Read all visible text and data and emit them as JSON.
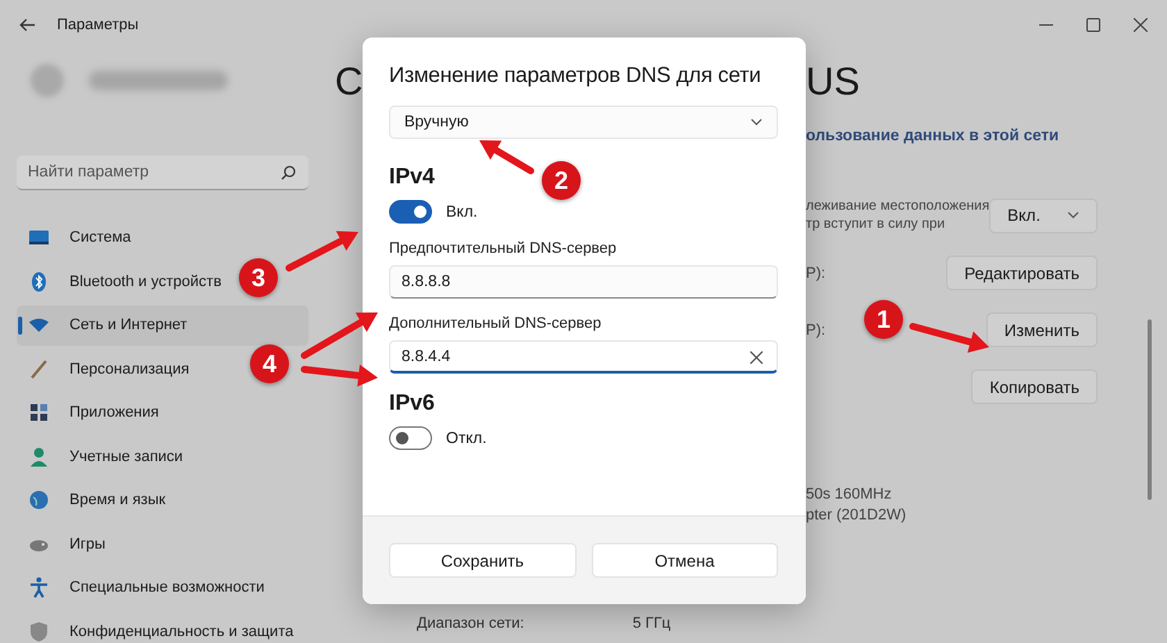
{
  "window": {
    "title": "Параметры"
  },
  "search": {
    "placeholder": "Найти параметр"
  },
  "sidebar": {
    "items": [
      {
        "label": "Система",
        "kind": "system",
        "selected": false
      },
      {
        "label": "Bluetooth и устройств",
        "kind": "bluetooth",
        "selected": false
      },
      {
        "label": "Сеть и Интернет",
        "kind": "network",
        "selected": true
      },
      {
        "label": "Персонализация",
        "kind": "brush",
        "selected": false
      },
      {
        "label": "Приложения",
        "kind": "apps",
        "selected": false
      },
      {
        "label": "Учетные записи",
        "kind": "person",
        "selected": false
      },
      {
        "label": "Время и язык",
        "kind": "globe",
        "selected": false
      },
      {
        "label": "Игры",
        "kind": "gamepad",
        "selected": false
      },
      {
        "label": "Специальные возможности",
        "kind": "accessibility",
        "selected": false
      },
      {
        "label": "Конфиденциальность и защита",
        "kind": "shield",
        "selected": false
      }
    ]
  },
  "page": {
    "heading_left": "С",
    "heading_right": "US",
    "link": "ользование данных в этой сети",
    "location_lines": [
      "леживание местоположения",
      "тр вступит в силу при"
    ],
    "location_dropdown": "Вкл.",
    "rows": [
      {
        "label": "P):",
        "button": "Редактировать"
      },
      {
        "label": "P):",
        "button": "Изменить"
      },
      {
        "label": "",
        "button": "Копировать"
      }
    ],
    "properties": [
      "50s 160MHz",
      "pter (201D2W)"
    ],
    "bottom": [
      {
        "label": "Диапазон сети:",
        "value": "5 ГГц"
      }
    ]
  },
  "dialog": {
    "title": "Изменение параметров DNS для сети",
    "mode": "Вручную",
    "sections": [
      {
        "heading": "IPv4",
        "toggle": {
          "on": true,
          "label": "Вкл."
        },
        "fields": [
          {
            "label": "Предпочтительный DNS-сервер",
            "value": "8.8.8.8",
            "focused": false
          },
          {
            "label": "Дополнительный DNS-сервер",
            "value": "8.8.4.4",
            "focused": true
          }
        ]
      },
      {
        "heading": "IPv6",
        "toggle": {
          "on": false,
          "label": "Откл."
        }
      }
    ],
    "buttons": [
      "Сохранить",
      "Отмена"
    ]
  },
  "annotations": [
    {
      "number": "1"
    },
    {
      "number": "2"
    },
    {
      "number": "3"
    },
    {
      "number": "4"
    }
  ]
}
